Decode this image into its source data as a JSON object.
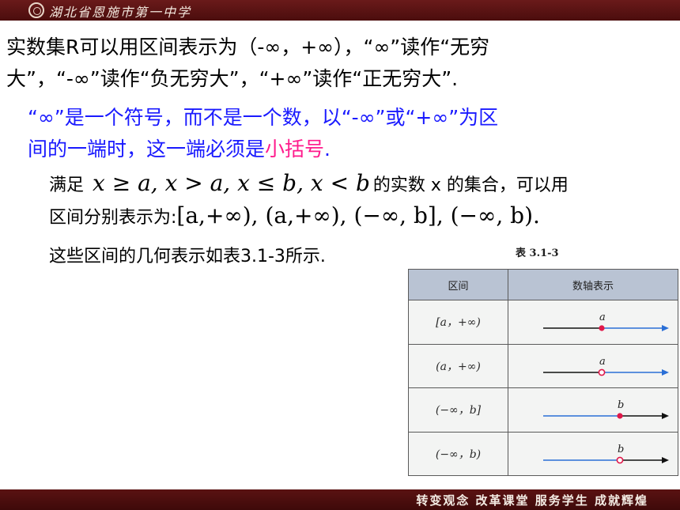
{
  "header": {
    "school_name": "湖北省恩施市第一中学"
  },
  "lines": {
    "line1": "实数集R可以用区间表示为（-∞，+∞），“∞”读作“无穷",
    "line2": "大”，“-∞”读作“负无穷大”，“+∞”读作“正无穷大”.",
    "note1": "“∞”是一个符号，而不是一个数，以“-∞”或“+∞”为区",
    "note2_prefix": "间的一端时，这一端必须是",
    "note2_highlight": "小括号",
    "note2_suffix": ".",
    "cond_prefix": "满足",
    "cond_math": "x ≥ a, x > a, x ≤ b, x < b",
    "cond_suffix": "的实数 x 的集合，可以用",
    "interval_prefix": "区间分别表示为:",
    "interval_math": "[a,+∞), (a,+∞), (−∞, b], (−∞, b).",
    "geom": "这些区间的几何表示如表3.1-3所示."
  },
  "table": {
    "caption": "表 3.1-3",
    "headers": [
      "区间",
      "数轴表示"
    ],
    "rows": [
      {
        "interval": "[a，+∞)",
        "label": "a",
        "dot": "filled",
        "arrow_color": "#2a6fd6"
      },
      {
        "interval": "(a，+∞)",
        "label": "a",
        "dot": "hollow",
        "arrow_color": "#2a6fd6"
      },
      {
        "interval": "(−∞，b]",
        "label": "b",
        "dot": "filled",
        "arrow_color": "#2a6fd6"
      },
      {
        "interval": "(−∞，b)",
        "label": "b",
        "dot": "hollow",
        "arrow_color": "#2a6fd6"
      }
    ]
  },
  "footer": {
    "motto": "转变观念 改革课堂 服务学生 成就辉煌"
  },
  "colors": {
    "header_bar": "#5a1414",
    "blue_text": "#1a1aff",
    "pink_text": "#ff1a8c",
    "dot_red": "#e0184a"
  }
}
